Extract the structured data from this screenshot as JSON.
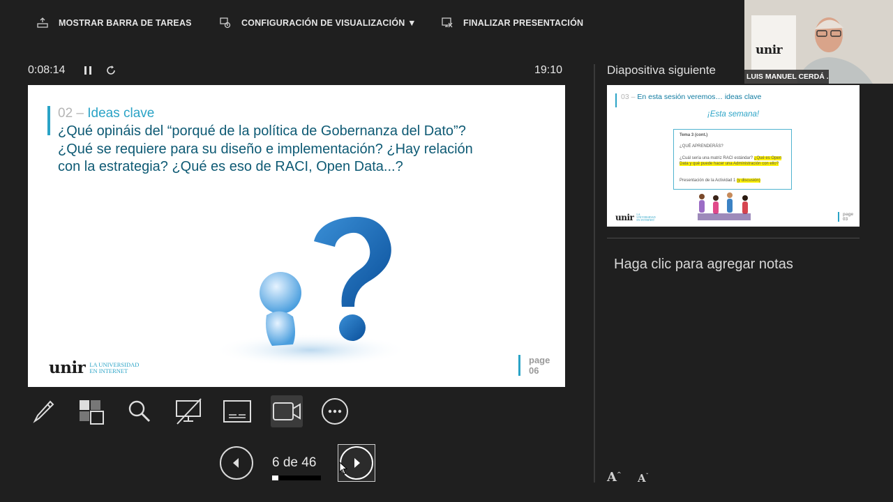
{
  "toolbar": {
    "show_taskbar": "MOSTRAR BARRA DE TAREAS",
    "display_settings": "CONFIGURACIÓN DE VISUALIZACIÓN ▼",
    "end_show": "FINALIZAR PRESENTACIÓN"
  },
  "timer": {
    "elapsed": "0:08:14",
    "clock": "19:10"
  },
  "slide": {
    "number": "02 –",
    "section": "Ideas clave",
    "question": "¿Qué opináis del “porqué de la política de Gobernanza del Dato”? ¿Qué se requiere para su diseño e implementación? ¿Hay relación con la estrategia? ¿Qué es eso de RACI, Open Data...?",
    "logo": "unir",
    "logo_sub_1": "LA UNIVERSIDAD",
    "logo_sub_2": "EN INTERNET",
    "page_word": "page",
    "page_num": "06"
  },
  "next_slide": {
    "label": "Diapositiva siguiente",
    "title_num": "03 –",
    "title": "En esta sesión veremos… ideas clave",
    "week": "¡Esta semana!",
    "box_topic": "Tema 3 (cont.)",
    "box_learn": "¿QUÉ APRENDERÁS?",
    "box_item1_a": "¿Cuál sería una matriz RACI estándar?",
    "box_item1_b": "¿Qué es Open Data y qué puede hacer una Administración con ello?",
    "box_item2_a": "Presentación de la Actividad 1",
    "box_item2_b": "(y discusión)",
    "logo": "unir",
    "logo_sub": "LA UNIVERSIDAD EN INTERNET",
    "page_word": "page",
    "page_num": "03"
  },
  "notes": {
    "placeholder": "Haga clic para agregar notas"
  },
  "navigation": {
    "counter": "6 de 46",
    "progress_fraction": 0.13
  },
  "webcam": {
    "name": "LUIS MANUEL CERDÁ ...",
    "logo": "unir"
  },
  "font_controls": {
    "increase": "A",
    "decrease": "A"
  },
  "colors": {
    "accent": "#2aa3c6",
    "title": "#0e5a74",
    "background": "#1f1f1f"
  }
}
